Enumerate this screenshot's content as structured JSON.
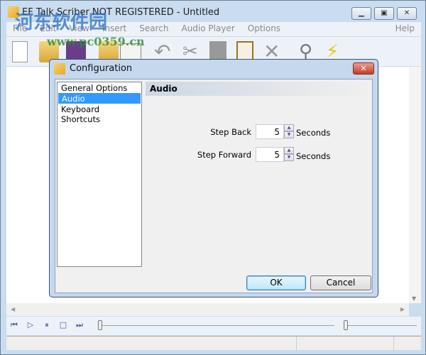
{
  "window": {
    "title": "EF Talk Scriber NOT REGISTERED - Untitled"
  },
  "menu": [
    "File",
    "Edit",
    "View",
    "Insert",
    "Search",
    "Audio Player",
    "Options",
    "Help"
  ],
  "watermark": {
    "line1": "河东软件园",
    "line2": "www.pc0359.cn"
  },
  "dialog": {
    "title": "Configuration",
    "close": "✕",
    "categories": [
      "General Options",
      "Audio",
      "Keyboard Shortcuts"
    ],
    "selected": "Audio",
    "section_title": "Audio",
    "step_back": {
      "label": "Step Back",
      "value": "5",
      "unit": "Seconds"
    },
    "step_forward": {
      "label": "Step Forward",
      "value": "5",
      "unit": "Seconds"
    },
    "ok": "OK",
    "cancel": "Cancel"
  }
}
